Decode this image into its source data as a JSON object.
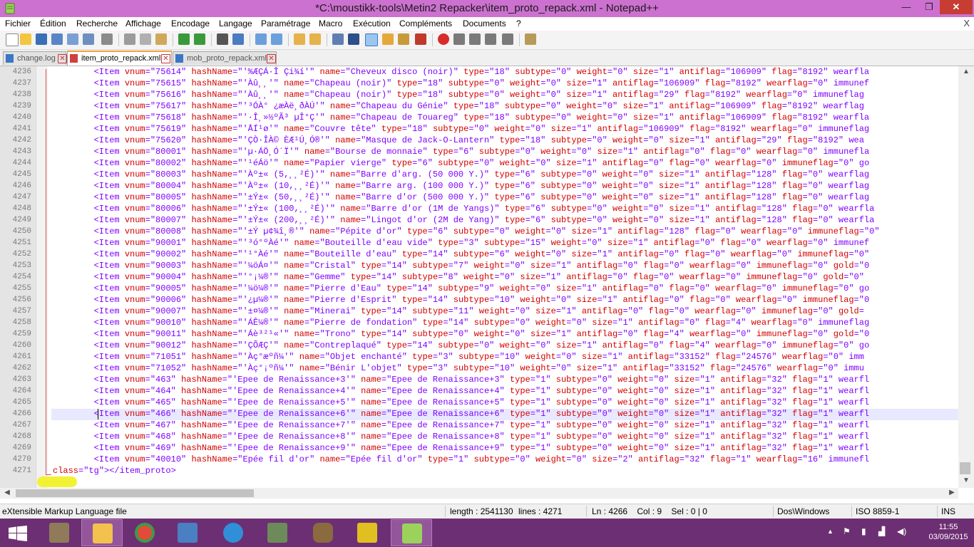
{
  "window": {
    "title": "*C:\\moustikk-tools\\Metin2 Repacker\\item_proto_repack.xml - Notepad++",
    "min_label": "—",
    "max_label": "❐",
    "close_label": "✕"
  },
  "menu": {
    "items": [
      "Fichier",
      "Édition",
      "Recherche",
      "Affichage",
      "Encodage",
      "Langage",
      "Paramétrage",
      "Macro",
      "Exécution",
      "Compléments",
      "Documents",
      "?"
    ],
    "close_label": "X"
  },
  "tabs": [
    {
      "label": "change.log",
      "active": false
    },
    {
      "label": "item_proto_repack.xml",
      "active": true
    },
    {
      "label": "mob_proto_repack.xml",
      "active": false
    }
  ],
  "editor": {
    "lines": [
      {
        "n": "4236",
        "text": "        <Item vnum=\"75614\" hashName=\"'%ÆÇÁ·Î Çi¾í'\" name=\"Cheveux disco (noir)\" type=\"18\" subtype=\"0\" weight=\"0\" size=\"1\" antiflag=\"106909\" flag=\"8192\" wearfla"
      },
      {
        "n": "4237",
        "text": "        <Item vnum=\"75615\" hashName=\"'Àû¸¸'\" name=\"Chapeau (noir)\" type=\"18\" subtype=\"0\" weight=\"0\" size=\"1\" antiflag=\"106909\" flag=\"8192\" wearflag=\"0\" immunef"
      },
      {
        "n": "4238",
        "text": "        <Item vnum=\"75616\" hashName=\"'Àû¸¸'\" name=\"Chapeau (noir)\" type=\"18\" subtype=\"0\" weight=\"0\" size=\"1\" antiflag=\"29\" flag=\"8192\" wearflag=\"0\" immuneflag"
      },
      {
        "n": "4239",
        "text": "        <Item vnum=\"75617\" hashName=\"'³ÓÀ° ¿æÀë¸ðÀÚ'\" name=\"Chapeau du Génie\" type=\"18\" subtype=\"0\" weight=\"0\" size=\"1\" antiflag=\"106909\" flag=\"8192\" wearflag"
      },
      {
        "n": "4240",
        "text": "        <Item vnum=\"75618\" hashName=\"'·Î¸»½ºÃ³ µÎ°Ç'\" name=\"Chapeau de Touareg\" type=\"18\" subtype=\"0\" weight=\"0\" size=\"1\" antiflag=\"106909\" flag=\"8192\" wearfla"
      },
      {
        "n": "4241",
        "text": "        <Item vnum=\"75619\" hashName=\"'ÅÍ¹ø'\" name=\"Couvre tête\" type=\"18\" subtype=\"0\" weight=\"0\" size=\"1\" antiflag=\"106909\" flag=\"8192\" wearflag=\"0\" immuneflag"
      },
      {
        "n": "4242",
        "text": "        <Item vnum=\"75620\" hashName=\"'ÇÒ·ÎÀ© ÈÆ¹Ú¸Ó®'\" name=\"Masque de Jack-O-Lantern\" type=\"18\" subtype=\"0\" weight=\"0\" size=\"1\" antiflag=\"29\" flag=\"8192\" wea"
      },
      {
        "n": "4243",
        "text": "        <Item vnum=\"80001\" hashName=\"'µ·ÁÖ¸Ó´Ï'\" name=\"Bourse de monnaie\" type=\"6\" subtype=\"0\" weight=\"0\" size=\"1\" antiflag=\"0\" flag=\"0\" wearflag=\"0\" immunefla"
      },
      {
        "n": "4244",
        "text": "        <Item vnum=\"80002\" hashName=\"'¹éÁö'\" name=\"Papier vierge\" type=\"6\" subtype=\"0\" weight=\"0\" size=\"1\" antiflag=\"0\" flag=\"0\" wearflag=\"0\" immuneflag=\"0\" go"
      },
      {
        "n": "4245",
        "text": "        <Item vnum=\"80003\" hashName=\"'Àº±« (5,¸¸²É)'\" name=\"Barre d'arg. (50 000 Y.)\" type=\"6\" subtype=\"0\" weight=\"0\" size=\"1\" antiflag=\"128\" flag=\"0\" wearflag"
      },
      {
        "n": "4246",
        "text": "        <Item vnum=\"80004\" hashName=\"'Àº±« (10,¸¸²É)'\" name=\"Barre arg. (100 000 Y.)\" type=\"6\" subtype=\"0\" weight=\"0\" size=\"1\" antiflag=\"128\" flag=\"0\" wearflag"
      },
      {
        "n": "4247",
        "text": "        <Item vnum=\"80005\" hashName=\"'±Ý±« (50,¸¸²É)'\" name=\"Barre d'or (500 000 Y.)\" type=\"6\" subtype=\"0\" weight=\"0\" size=\"1\" antiflag=\"128\" flag=\"0\" wearflag"
      },
      {
        "n": "4248",
        "text": "        <Item vnum=\"80006\" hashName=\"'±Ý±« (100,¸¸²É)'\" name=\"Barre d'or (1M de Yangs)\" type=\"6\" subtype=\"0\" weight=\"0\" size=\"1\" antiflag=\"128\" flag=\"0\" wearfla"
      },
      {
        "n": "4249",
        "text": "        <Item vnum=\"80007\" hashName=\"'±Ý±« (200,¸¸²É)'\" name=\"Lingot d'or (2M de Yang)\" type=\"6\" subtype=\"0\" weight=\"0\" size=\"1\" antiflag=\"128\" flag=\"0\" wearfla"
      },
      {
        "n": "4250",
        "text": "        <Item vnum=\"80008\" hashName=\"'±Ý µ¢¾î¸®'\" name=\"Pépite d'or\" type=\"6\" subtype=\"0\" weight=\"0\" size=\"1\" antiflag=\"128\" flag=\"0\" wearflag=\"0\" immuneflag=\"0\""
      },
      {
        "n": "4251",
        "text": "        <Item vnum=\"90001\" hashName=\"'³ó°ºÀé'\" name=\"Bouteille d'eau vide\" type=\"3\" subtype=\"15\" weight=\"0\" size=\"1\" antiflag=\"0\" flag=\"0\" wearflag=\"0\" immunef"
      },
      {
        "n": "4252",
        "text": "        <Item vnum=\"90002\" hashName=\"'¹°Àé'\" name=\"Bouteille d'eau\" type=\"14\" subtype=\"6\" weight=\"0\" size=\"1\" antiflag=\"0\" flag=\"0\" wearflag=\"0\" immuneflag=\"0\""
      },
      {
        "n": "4253",
        "text": "        <Item vnum=\"90003\" hashName=\"'¼öÁ¤'\" name=\"Cristal\" type=\"14\" subtype=\"7\" weight=\"0\" size=\"1\" antiflag=\"0\" flag=\"0\" wearflag=\"0\" immuneflag=\"0\" gold=\"0"
      },
      {
        "n": "4254",
        "text": "        <Item vnum=\"90004\" hashName=\"'°¡¼®'\" name=\"Gemme\" type=\"14\" subtype=\"8\" weight=\"0\" size=\"1\" antiflag=\"0\" flag=\"0\" wearflag=\"0\" immuneflag=\"0\" gold=\"0\""
      },
      {
        "n": "4255",
        "text": "        <Item vnum=\"90005\" hashName=\"'¼ö¼®'\" name=\"Pierre d'Eau\" type=\"14\" subtype=\"9\" weight=\"0\" size=\"1\" antiflag=\"0\" flag=\"0\" wearflag=\"0\" immuneflag=\"0\" go"
      },
      {
        "n": "4256",
        "text": "        <Item vnum=\"90006\" hashName=\"'¿µ¼®'\" name=\"Pierre d'Esprit\" type=\"14\" subtype=\"10\" weight=\"0\" size=\"1\" antiflag=\"0\" flag=\"0\" wearflag=\"0\" immuneflag=\"0"
      },
      {
        "n": "4257",
        "text": "        <Item vnum=\"90007\" hashName=\"'±¤¼®'\" name=\"Minerai\" type=\"14\" subtype=\"11\" weight=\"0\" size=\"1\" antiflag=\"0\" flag=\"0\" wearflag=\"0\" immuneflag=\"0\" gold="
      },
      {
        "n": "4258",
        "text": "        <Item vnum=\"90010\" hashName=\"'ÁÊ¼®'\" name=\"Pierre de fondation\" type=\"14\" subtype=\"0\" weight=\"0\" size=\"1\" antiflag=\"0\" flag=\"4\" wearflag=\"0\" immuneflag"
      },
      {
        "n": "4259",
        "text": "        <Item vnum=\"90011\" hashName=\"'Áè³²¹«'\" name=\"Trono\" type=\"14\" subtype=\"0\" weight=\"0\" size=\"1\" antiflag=\"0\" flag=\"4\" wearflag=\"0\" immuneflag=\"0\" gold=\"0"
      },
      {
        "n": "4260",
        "text": "        <Item vnum=\"90012\" hashName=\"'ÇÕÆÇ'\" name=\"Contreplaqué\" type=\"14\" subtype=\"0\" weight=\"0\" size=\"1\" antiflag=\"0\" flag=\"4\" wearflag=\"0\" immuneflag=\"0\" go"
      },
      {
        "n": "4261",
        "text": "        <Item vnum=\"71051\" hashName=\"'Àç°æºñ¼­'\" name=\"Objet enchanté\" type=\"3\" subtype=\"10\" weight=\"0\" size=\"1\" antiflag=\"33152\" flag=\"24576\" wearflag=\"0\" imm"
      },
      {
        "n": "4262",
        "text": "        <Item vnum=\"71052\" hashName=\"'Àç°¡ºñ¼­'\" name=\"Bénir L'objet\" type=\"3\" subtype=\"10\" weight=\"0\" size=\"1\" antiflag=\"33152\" flag=\"24576\" wearflag=\"0\" immu"
      },
      {
        "n": "4263",
        "text": "        <Item vnum=\"463\" hashName=\"'Epee de Renaissance+3'\" name=\"Epee de Renaissance+3\" type=\"1\" subtype=\"0\" weight=\"0\" size=\"1\" antiflag=\"32\" flag=\"1\" wearfl"
      },
      {
        "n": "4264",
        "text": "        <Item vnum=\"464\" hashName=\"'Epee de Renaissance+4'\" name=\"Epee de Renaissance+4\" type=\"1\" subtype=\"0\" weight=\"0\" size=\"1\" antiflag=\"32\" flag=\"1\" wearfl"
      },
      {
        "n": "4265",
        "text": "        <Item vnum=\"465\" hashName=\"'Epee de Renaissance+5'\" name=\"Epee de Renaissance+5\" type=\"1\" subtype=\"0\" weight=\"0\" size=\"1\" antiflag=\"32\" flag=\"1\" wearfl"
      },
      {
        "n": "4266",
        "text": "        <Item vnum=\"466\" hashName=\"'Epee de Renaissance+6'\" name=\"Epee de Renaissance+6\" type=\"1\" subtype=\"0\" weight=\"0\" size=\"1\" antiflag=\"32\" flag=\"1\" wearfl"
      },
      {
        "n": "4267",
        "text": "        <Item vnum=\"467\" hashName=\"'Epee de Renaissance+7'\" name=\"Epee de Renaissance+7\" type=\"1\" subtype=\"0\" weight=\"0\" size=\"1\" antiflag=\"32\" flag=\"1\" wearfl"
      },
      {
        "n": "4268",
        "text": "        <Item vnum=\"468\" hashName=\"'Epee de Renaissance+8'\" name=\"Epee de Renaissance+8\" type=\"1\" subtype=\"0\" weight=\"0\" size=\"1\" antiflag=\"32\" flag=\"1\" wearfl"
      },
      {
        "n": "4269",
        "text": "        <Item vnum=\"469\" hashName=\"'Epee de Renaissance+9'\" name=\"Epee de Renaissance+9\" type=\"1\" subtype=\"0\" weight=\"0\" size=\"1\" antiflag=\"32\" flag=\"1\" wearfl"
      },
      {
        "n": "4270",
        "text": "        <Item vnum=\"40010\" hashName=\"Epée fil d'or\" name=\"Epée fil d'or\" type=\"1\" subtype=\"0\" weight=\"0\" size=\"2\" antiflag=\"32\" flag=\"1\" wearflag=\"16\" immunefl"
      },
      {
        "n": "4271",
        "text": "</item_proto>"
      }
    ]
  },
  "status": {
    "filetype": "eXtensible Markup Language file",
    "length": "length : 2541130",
    "lines": "lines : 4271",
    "position": "Ln : 4266    Col : 9    Sel : 0 | 0",
    "eol": "Dos\\Windows",
    "encoding": "ISO 8859-1",
    "mode": "INS"
  },
  "taskbar": {
    "time": "11:55",
    "date": "03/09/2015",
    "apps": [
      "start",
      "gimp",
      "file-explorer",
      "chrome",
      "virtualbox",
      "network-app",
      "network-monitor",
      "bag",
      "winrar-wd",
      "notepad-plus-plus"
    ]
  },
  "colors": {
    "titlebar": "#cc71cf",
    "taskbar": "#6d2f73",
    "tag": "#0000e6",
    "attribute": "#d40000",
    "value": "#7f007f"
  }
}
